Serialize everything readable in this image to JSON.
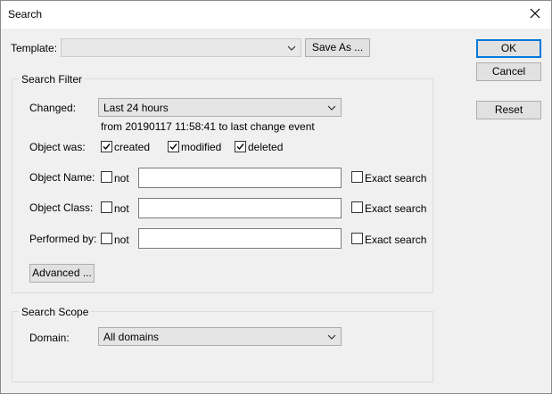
{
  "window": {
    "title": "Search"
  },
  "template": {
    "label": "Template:",
    "value": "",
    "save_as_label": "Save As ..."
  },
  "buttons": {
    "ok": "OK",
    "cancel": "Cancel",
    "reset": "Reset"
  },
  "search_filter": {
    "title": "Search Filter",
    "changed_label": "Changed:",
    "changed_value": "Last 24 hours",
    "changed_info": "from 20190117 11:58:41 to last change event",
    "object_was_label": "Object was:",
    "object_was": [
      {
        "label": "created",
        "checked": true
      },
      {
        "label": "modified",
        "checked": true
      },
      {
        "label": "deleted",
        "checked": true
      }
    ],
    "rows": [
      {
        "label": "Object Name:",
        "not_label": "not",
        "value": "",
        "exact_label": "Exact search"
      },
      {
        "label": "Object Class:",
        "not_label": "not",
        "value": "",
        "exact_label": "Exact search"
      },
      {
        "label": "Performed by:",
        "not_label": "not",
        "value": "",
        "exact_label": "Exact search"
      }
    ],
    "advanced_label": "Advanced ..."
  },
  "search_scope": {
    "title": "Search Scope",
    "domain_label": "Domain:",
    "domain_value": "All domains"
  }
}
